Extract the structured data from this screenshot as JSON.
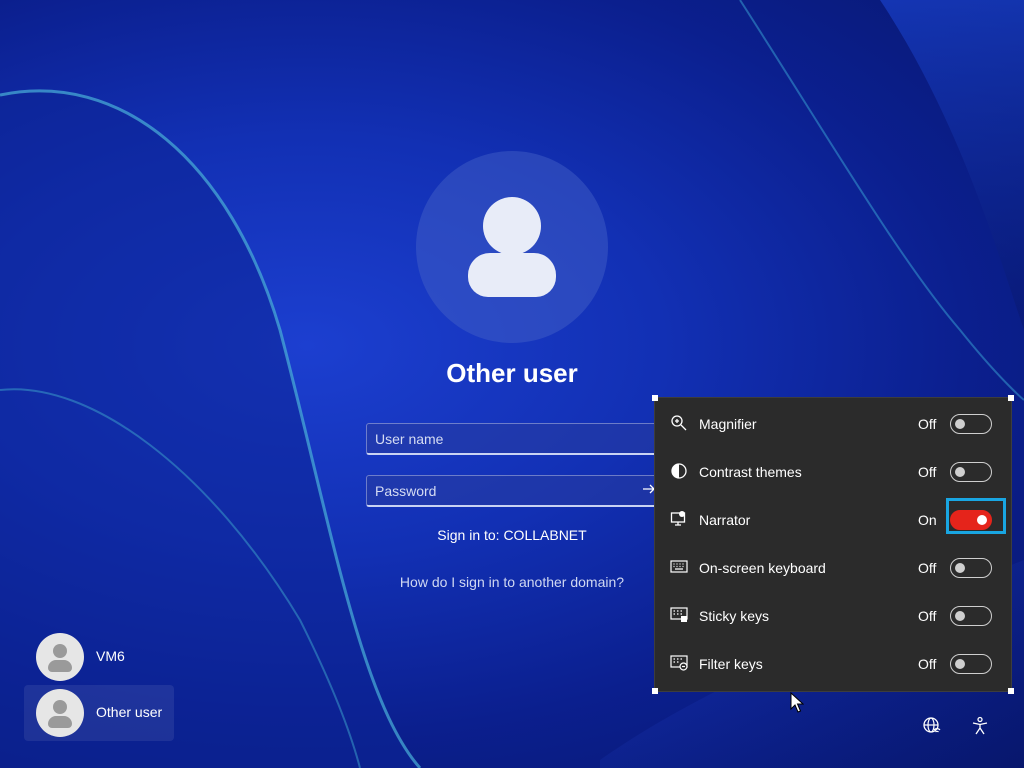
{
  "login": {
    "user_title": "Other user",
    "username_placeholder": "User name",
    "password_placeholder": "Password",
    "signin_to": "Sign in to: COLLABNET",
    "other_domain_link": "How do I sign in to another domain?"
  },
  "users": [
    {
      "name": "VM6",
      "selected": false
    },
    {
      "name": "Other user",
      "selected": true
    }
  ],
  "accessibility": {
    "items": [
      {
        "label": "Magnifier",
        "state": "Off",
        "icon": "magnifier-icon"
      },
      {
        "label": "Contrast themes",
        "state": "Off",
        "icon": "contrast-icon"
      },
      {
        "label": "Narrator",
        "state": "On",
        "icon": "narrator-icon"
      },
      {
        "label": "On-screen keyboard",
        "state": "Off",
        "icon": "keyboard-icon"
      },
      {
        "label": "Sticky keys",
        "state": "Off",
        "icon": "sticky-keys-icon"
      },
      {
        "label": "Filter keys",
        "state": "Off",
        "icon": "filter-keys-icon"
      }
    ]
  },
  "colors": {
    "toggle_on": "#e5241b",
    "focus_ring": "#19a6e2",
    "panel_bg": "#2b2b2b"
  }
}
